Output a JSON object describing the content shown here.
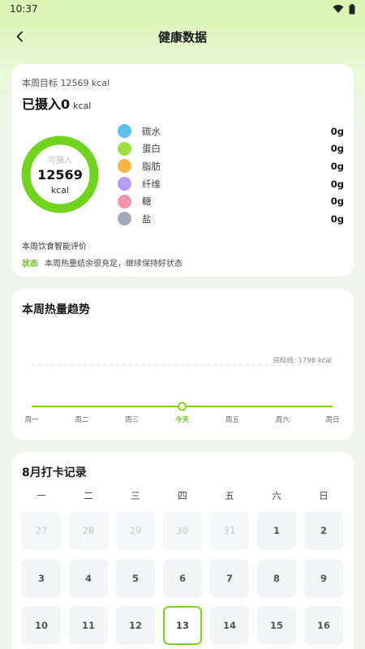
{
  "status_bar": {
    "time": "10:37"
  },
  "nav": {
    "title": "健康数据"
  },
  "summary": {
    "goal_text": "本周目标 12569 kcal",
    "intake_label": "已摄入0",
    "intake_unit": "kcal",
    "ring": {
      "label": "可摄入",
      "value": "12569",
      "unit": "kcal",
      "remaining_fraction": 1.0
    },
    "nutrients": [
      {
        "name": "碳水",
        "value": "0g",
        "color": "#5bc2f0"
      },
      {
        "name": "蛋白",
        "value": "0g",
        "color": "#9fe041"
      },
      {
        "name": "脂肪",
        "value": "0g",
        "color": "#fbb446"
      },
      {
        "name": "纤维",
        "value": "0g",
        "color": "#b79bf7"
      },
      {
        "name": "糖",
        "value": "0g",
        "color": "#f494ad"
      },
      {
        "name": "盐",
        "value": "0g",
        "color": "#a4abb8"
      }
    ],
    "evaluation_title": "本周饮食智能评价",
    "evaluation_badge": "状态",
    "evaluation_text": "本周热量结余很充足，继续保持好状态"
  },
  "trend": {
    "title": "本周热量趋势",
    "goal_label": "目标线: 1796 kcal",
    "days": [
      "周一",
      "周二",
      "周三",
      "今天",
      "周五",
      "周六",
      "周日"
    ],
    "today_index": 3,
    "values": [
      0,
      0,
      0,
      0,
      0,
      0,
      0
    ],
    "colors": {
      "line": "#7ed321",
      "goal": "#d8d8d8"
    }
  },
  "calendar": {
    "title": "8月打卡记录",
    "weekdays": [
      "一",
      "二",
      "三",
      "四",
      "五",
      "六",
      "日"
    ],
    "rows": [
      [
        {
          "d": "27",
          "other": true
        },
        {
          "d": "28",
          "other": true
        },
        {
          "d": "29",
          "other": true
        },
        {
          "d": "30",
          "other": true
        },
        {
          "d": "31",
          "other": true
        },
        {
          "d": "1"
        },
        {
          "d": "2"
        }
      ],
      [
        {
          "d": "3"
        },
        {
          "d": "4"
        },
        {
          "d": "5"
        },
        {
          "d": "6"
        },
        {
          "d": "7"
        },
        {
          "d": "8"
        },
        {
          "d": "9"
        }
      ],
      [
        {
          "d": "10"
        },
        {
          "d": "11"
        },
        {
          "d": "12"
        },
        {
          "d": "13",
          "today": true
        },
        {
          "d": "14"
        },
        {
          "d": "15"
        },
        {
          "d": "16"
        }
      ]
    ]
  }
}
